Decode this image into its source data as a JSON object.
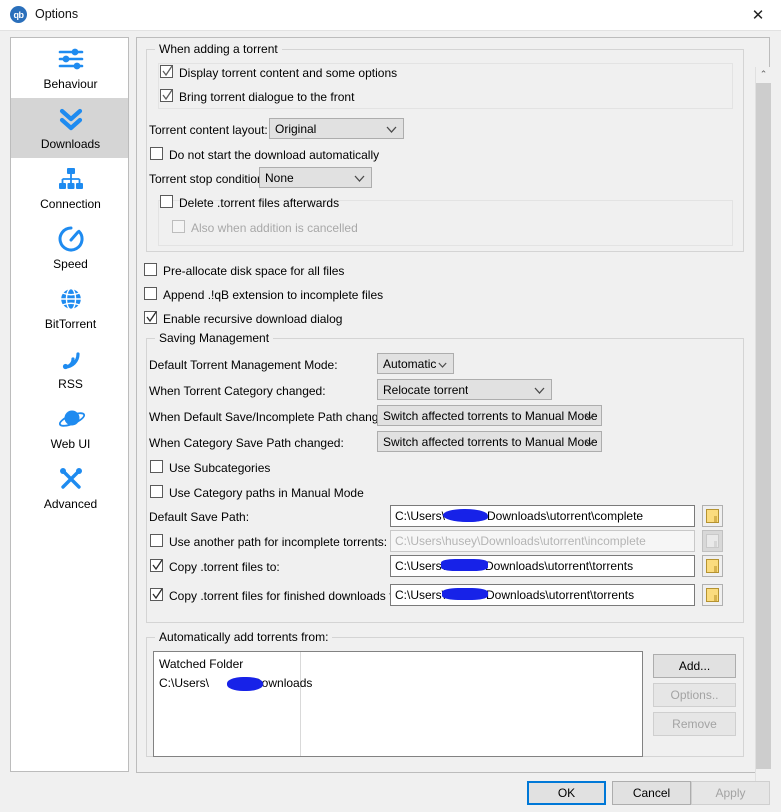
{
  "window": {
    "title": "Options",
    "logo_text": "qb",
    "close_icon": "✕"
  },
  "sidebar": {
    "items": [
      {
        "label": "Behaviour",
        "icon": "sliders-icon",
        "selected": false
      },
      {
        "label": "Downloads",
        "icon": "double-chevron-down-icon",
        "selected": true
      },
      {
        "label": "Connection",
        "icon": "network-icon",
        "selected": false
      },
      {
        "label": "Speed",
        "icon": "speedometer-icon",
        "selected": false
      },
      {
        "label": "BitTorrent",
        "icon": "globe-icon",
        "selected": false
      },
      {
        "label": "RSS",
        "icon": "rss-icon",
        "selected": false
      },
      {
        "label": "Web UI",
        "icon": "planet-icon",
        "selected": false
      },
      {
        "label": "Advanced",
        "icon": "tools-icon",
        "selected": false
      }
    ]
  },
  "adding": {
    "group_label": "When adding a torrent",
    "display_content": "Display torrent content and some options",
    "bring_front": "Bring torrent dialogue to the front",
    "content_layout_label": "Torrent content layout:",
    "content_layout_value": "Original",
    "no_autostart": "Do not start the download automatically",
    "stop_condition_label": "Torrent stop condition:",
    "stop_condition_value": "None",
    "delete_after": "Delete .torrent files afterwards",
    "also_cancelled": "Also when addition is cancelled"
  },
  "standalone": {
    "preallocate": "Pre-allocate disk space for all files",
    "append_ext": "Append .!qB extension to incomplete files",
    "recursive": "Enable recursive download dialog"
  },
  "saving": {
    "group_label": "Saving Management",
    "tmm_label": "Default Torrent Management Mode:",
    "tmm_value": "Automatic",
    "category_changed_label": "When Torrent Category changed:",
    "category_changed_value": "Relocate torrent",
    "default_path_changed_label": "When Default Save/Incomplete Path changed:",
    "default_path_changed_value": "Switch affected torrents to Manual Mode",
    "category_path_changed_label": "When Category Save Path changed:",
    "category_path_changed_value": "Switch affected torrents to Manual Mode",
    "use_subcategories": "Use Subcategories",
    "use_category_paths": "Use Category paths in Manual Mode",
    "default_save_label": "Default Save Path:",
    "default_save_prefix": "C:\\Users\\",
    "default_save_suffix": "Downloads\\utorrent\\complete",
    "incomplete_label": "Use another path for incomplete torrents:",
    "incomplete_placeholder": "C:\\Users\\husey\\Downloads\\utorrent\\incomplete",
    "copy_torrent_label": "Copy .torrent files to:",
    "copy_torrent_prefix": "C:\\Users\\",
    "copy_torrent_suffix": "Downloads\\utorrent\\torrents",
    "copy_finished_label": "Copy .torrent files for finished downloads to:",
    "copy_finished_prefix": "C:\\Users\\",
    "copy_finished_suffix": "Downloads\\utorrent\\torrents"
  },
  "watched": {
    "group_label": "Automatically add torrents from:",
    "column_header": "Watched Folder",
    "row_prefix": "C:\\Users\\",
    "row_suffix": "Downloads",
    "add_button": "Add...",
    "options_button": "Options..",
    "remove_button": "Remove"
  },
  "scrollbar": {
    "up_arrow": "⌃",
    "down_arrow": "⌄"
  },
  "footer": {
    "ok": "OK",
    "cancel": "Cancel",
    "apply": "Apply"
  },
  "colors": {
    "accent": "#1e8bf0",
    "focus": "#0078d7",
    "redaction": "#1722e8",
    "selected_bg": "#d5d5d5"
  }
}
